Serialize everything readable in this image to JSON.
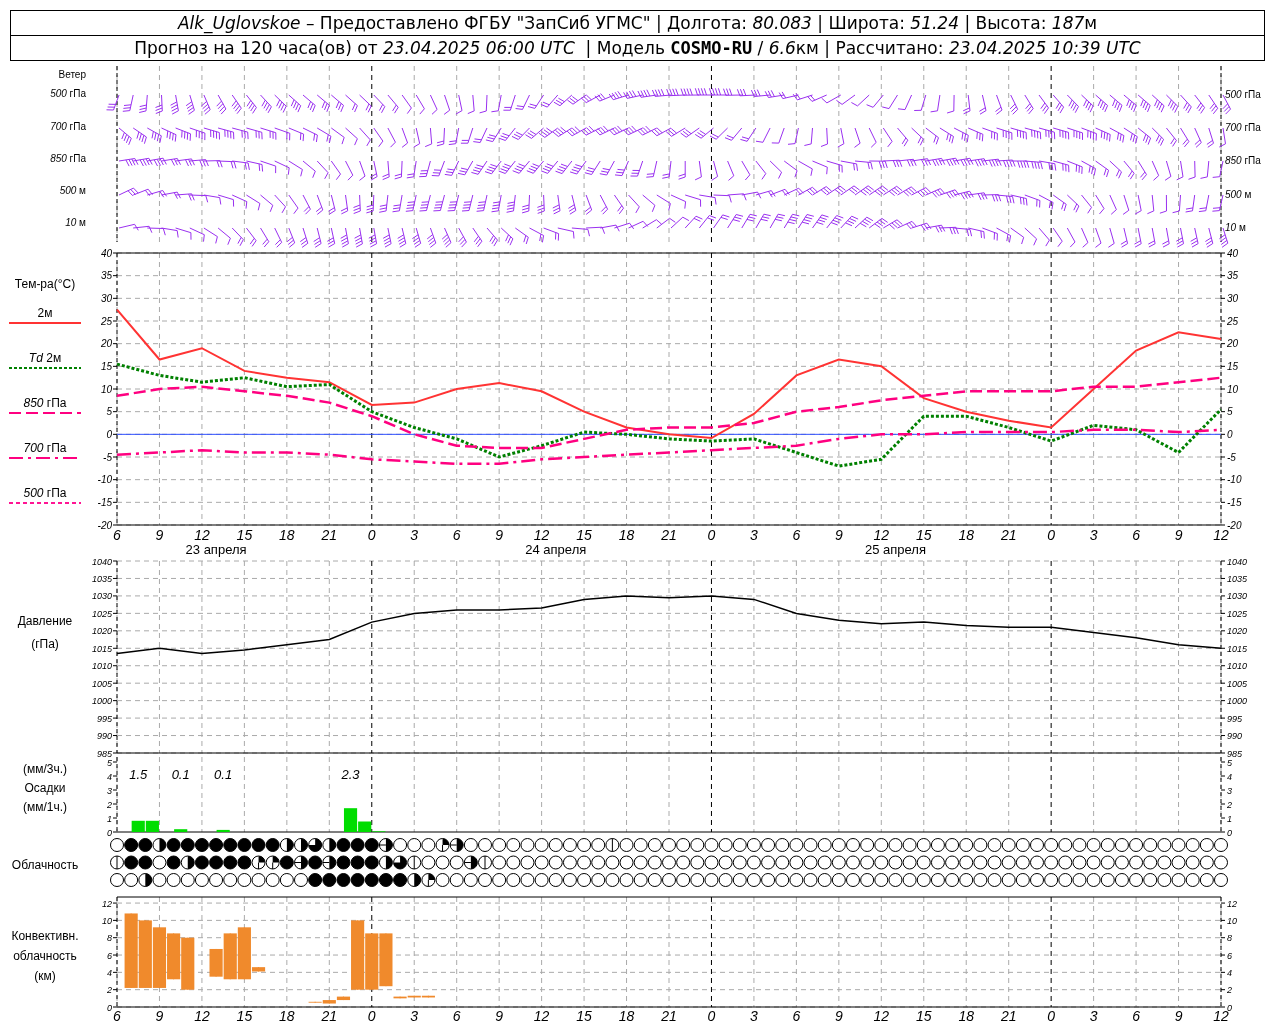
{
  "header": {
    "line_1": {
      "station": "Alk_Uglovskoe",
      "source": " – Предоставлено ФГБУ \"ЗапСиб УГМС\" | Долгота: ",
      "longitude": "80.083",
      "latitude_label": " | Широта: ",
      "latitude": "51.24",
      "altitude_label": " | Высота: ",
      "altitude": "187",
      "altitude_unit": "м"
    },
    "line_2": {
      "prefix": "Прогноз на 120 часа(ов) от ",
      "start": "23.04.2025 06:00 UTC",
      "model_label": "  | Модель ",
      "model": "COSMO-RU",
      "separator": " / ",
      "resolution": "6.6",
      "calc_label": "км | Рассчитано: ",
      "calculated": "23.04.2025 10:39 UTC"
    }
  },
  "wind": {
    "title": "Ветер",
    "levels_left": [
      "*500* гПа",
      "*700* гПа",
      "*850* гПа",
      "*500* м",
      "*10* м"
    ],
    "levels_right": [
      "*500* гПа",
      "*700* гПа",
      "*850* гПа",
      "*500* м",
      "*10* м"
    ]
  },
  "temperature": {
    "title": "Тем-ра(°C)",
    "legend": [
      {
        "label": "2м",
        "color": "#ff3333",
        "kind": "solid"
      },
      {
        "label": "*Td* 2м",
        "color": "#008000",
        "kind": "dotted"
      },
      {
        "label": "*850* гПа",
        "color": "#ff0080",
        "kind": "dashed"
      },
      {
        "label": "*700* гПа",
        "color": "#ff0080",
        "kind": "dashdot"
      },
      {
        "label": "*500* гПа",
        "color": "#ff1493",
        "kind": "short"
      }
    ],
    "chart_data": {
      "type": "line",
      "grid": true,
      "categories": [
        "6",
        "9",
        "12",
        "15",
        "18",
        "21",
        "0",
        "3",
        "6",
        "9",
        "12",
        "15",
        "18",
        "21",
        "0",
        "3",
        "6",
        "9",
        "12",
        "15",
        "18",
        "21",
        "0",
        "3",
        "6",
        "9",
        "12"
      ],
      "series": [
        {
          "color": "#ff3333",
          "line_style": "solid",
          "values": [
            27.5,
            16.5,
            19,
            14,
            12.5,
            11.5,
            6.5,
            7,
            10,
            11.3,
            9.5,
            5,
            1.5,
            0,
            -0.8,
            4.5,
            13,
            16.5,
            15,
            8,
            5,
            3,
            1.5,
            10,
            18.5,
            22.5,
            21
          ]
        },
        {
          "color": "#008000",
          "line_style": "dotted",
          "values": [
            15.5,
            13,
            11.5,
            12.5,
            10.5,
            11,
            5,
            1.5,
            -1,
            -5,
            -2.5,
            0.5,
            0,
            -1,
            -1.5,
            -1,
            -4,
            -7,
            -5.5,
            4,
            4,
            1.5,
            -1.5,
            2,
            1,
            -4,
            5.5
          ]
        },
        {
          "color": "#ff0080",
          "line_style": "dashed",
          "values": [
            8.5,
            10,
            10.5,
            9.5,
            8.5,
            7,
            4,
            0,
            -2.5,
            -3,
            -3,
            -1,
            1,
            1.5,
            1.5,
            2.5,
            5,
            6,
            7.5,
            8.5,
            9.5,
            9.5,
            9.5,
            10.5,
            10.5,
            11.5,
            12.5
          ]
        },
        {
          "color": "#ff0080",
          "line_style": "dashdot",
          "values": [
            -4.5,
            -4,
            -3.5,
            -4,
            -4,
            -4.5,
            -5.5,
            -6,
            -6.5,
            -6.5,
            -5.5,
            -5,
            -4.5,
            -4,
            -3.5,
            -3,
            -2.5,
            -1,
            0,
            0,
            0.5,
            0.5,
            0.5,
            1,
            1,
            0.5,
            1
          ]
        }
      ],
      "ref_lines": [
        {
          "axis": "y",
          "value": 0,
          "color": "#3050ff"
        }
      ],
      "ylim": [
        -20,
        40
      ],
      "yticks": [
        -20,
        -15,
        -10,
        -5,
        0,
        5,
        10,
        15,
        20,
        25,
        30,
        35,
        40
      ]
    },
    "right_axis_labels": [
      "40",
      "35",
      "30",
      "25",
      "20",
      "15",
      "10",
      "5",
      "0",
      "-5",
      "-10",
      "-15",
      "-20"
    ],
    "day_labels": [
      "23 апреля",
      "24 апреля",
      "25 апреля"
    ]
  },
  "pressure": {
    "title": "Давление",
    "unit": "(гПа)",
    "right_axis_labels": [
      "1040",
      "1035",
      "1030",
      "1025",
      "1020",
      "1015",
      "1010",
      "1005",
      "1000",
      "995",
      "990",
      "985"
    ],
    "chart_data": {
      "type": "line",
      "grid": true,
      "categories": [
        null,
        null,
        null,
        null,
        null,
        null,
        null,
        null,
        null,
        null,
        null,
        null,
        null,
        null,
        null,
        null,
        null,
        null,
        null,
        null,
        null,
        null,
        null,
        null,
        null,
        null,
        null
      ],
      "series": [
        {
          "color": "#000000",
          "values": [
            1013.5,
            1015,
            1013.5,
            1014.5,
            1016,
            1017.5,
            1022.5,
            1025,
            1026,
            1026,
            1026.5,
            1029,
            1030,
            1029.5,
            1030,
            1029,
            1025,
            1023,
            1022,
            1022.5,
            1021.5,
            1021,
            1021,
            1019.5,
            1018,
            1016,
            1015
          ]
        }
      ],
      "ylim": [
        985,
        1040
      ],
      "yticks": [
        985,
        990,
        995,
        1000,
        1005,
        1010,
        1015,
        1020,
        1025,
        1030,
        1035,
        1040
      ]
    }
  },
  "precipitation": {
    "unit_top": "(мм/3ч.)",
    "title": "Осадки",
    "unit_bottom": "(мм/1ч.)",
    "right_axis_labels": [
      "5",
      "4",
      "3",
      "2",
      "1",
      "0"
    ],
    "chart_data": {
      "type": "bar",
      "grid": true,
      "categories": [
        null,
        null,
        null,
        null,
        null,
        null,
        null,
        null,
        null,
        null,
        null,
        null,
        null,
        null,
        null,
        null,
        null,
        null,
        null,
        null,
        null,
        null,
        null,
        null,
        null,
        null,
        null,
        null,
        null,
        null,
        null,
        null,
        null,
        null,
        null,
        null,
        null,
        null,
        null,
        null,
        null,
        null,
        null,
        null,
        null,
        null,
        null,
        null,
        null,
        null,
        null,
        null,
        null,
        null,
        null,
        null,
        null,
        null,
        null,
        null,
        null,
        null,
        null,
        null,
        null,
        null,
        null,
        null,
        null,
        null,
        null,
        null,
        null,
        null,
        null,
        null,
        null,
        null
      ],
      "series": [
        {
          "color": "#00dd00",
          "values": [
            0,
            0.8,
            0.8,
            0,
            0.2,
            0,
            0,
            0.15,
            0,
            0,
            0,
            0,
            0,
            0,
            0,
            0,
            1.7,
            0.75,
            0.05,
            0,
            0,
            0,
            0,
            0,
            0,
            0,
            0,
            0,
            0,
            0,
            0,
            0,
            0,
            0,
            0,
            0,
            0,
            0,
            0,
            0,
            0,
            0,
            0,
            0,
            0,
            0,
            0,
            0,
            0,
            0,
            0,
            0,
            0,
            0,
            0,
            0,
            0,
            0,
            0,
            0,
            0,
            0,
            0,
            0,
            0,
            0,
            0,
            0,
            0,
            0,
            0,
            0,
            0,
            0,
            0,
            0,
            0,
            0
          ]
        }
      ],
      "ylim": [
        0,
        5
      ],
      "yticks": [
        0,
        1,
        2,
        3,
        4,
        5
      ],
      "annotations": [
        "1.5",
        "0.1",
        "0.1",
        "2.3"
      ]
    }
  },
  "cloudiness": {
    "title": "Облачность",
    "rows": [
      {
        "cells": [
          {
            "kind": "clear"
          },
          {
            "kind": "overcast"
          },
          {
            "kind": "overcast"
          },
          {
            "kind": "half"
          },
          {
            "kind": "overcast"
          },
          {
            "kind": "overcast"
          },
          {
            "kind": "overcast"
          },
          {
            "kind": "overcast"
          },
          {
            "kind": "overcast"
          },
          {
            "kind": "overcast"
          },
          {
            "kind": "overcast"
          },
          {
            "kind": "overcast"
          },
          {
            "kind": "half"
          },
          {
            "kind": "half"
          },
          {
            "kind": "most"
          },
          {
            "kind": "half"
          },
          {
            "kind": "overcast"
          },
          {
            "kind": "overcast"
          },
          {
            "kind": "overcast"
          },
          {
            "kind": "split"
          },
          {
            "kind": "clear"
          },
          {
            "kind": "clear"
          },
          {
            "kind": "clear"
          },
          {
            "kind": "quarter"
          },
          {
            "kind": "split"
          },
          {
            "kind": "clear"
          },
          {
            "kind": "clear"
          },
          {
            "kind": "clear"
          },
          {
            "kind": "clear"
          },
          {
            "kind": "clear"
          },
          {
            "kind": "clear"
          },
          {
            "kind": "clear"
          },
          {
            "kind": "clear"
          },
          {
            "kind": "clear"
          },
          {
            "kind": "clear"
          },
          {
            "kind": "trace"
          },
          {
            "kind": "clear"
          },
          {
            "kind": "clear"
          },
          {
            "kind": "clear"
          },
          {
            "kind": "clear"
          },
          {
            "kind": "clear"
          },
          {
            "kind": "clear"
          },
          {
            "kind": "clear"
          },
          {
            "kind": "clear"
          },
          {
            "kind": "clear"
          },
          {
            "kind": "clear"
          },
          {
            "kind": "clear"
          },
          {
            "kind": "clear"
          },
          {
            "kind": "clear"
          },
          {
            "kind": "clear"
          },
          {
            "kind": "clear"
          },
          {
            "kind": "clear"
          },
          {
            "kind": "clear"
          },
          {
            "kind": "clear"
          },
          {
            "kind": "clear"
          },
          {
            "kind": "clear"
          },
          {
            "kind": "clear"
          },
          {
            "kind": "clear"
          },
          {
            "kind": "clear"
          },
          {
            "kind": "clear"
          },
          {
            "kind": "clear"
          },
          {
            "kind": "clear"
          },
          {
            "kind": "clear"
          },
          {
            "kind": "clear"
          },
          {
            "kind": "clear"
          },
          {
            "kind": "clear"
          },
          {
            "kind": "clear"
          },
          {
            "kind": "clear"
          },
          {
            "kind": "clear"
          },
          {
            "kind": "clear"
          },
          {
            "kind": "clear"
          },
          {
            "kind": "clear"
          },
          {
            "kind": "clear"
          },
          {
            "kind": "clear"
          },
          {
            "kind": "clear"
          },
          {
            "kind": "clear"
          },
          {
            "kind": "clear"
          },
          {
            "kind": "clear"
          },
          {
            "kind": "clear"
          }
        ]
      },
      {
        "cells": [
          {
            "kind": "trace"
          },
          {
            "kind": "overcast"
          },
          {
            "kind": "overcast"
          },
          {
            "kind": "clear"
          },
          {
            "kind": "overcast"
          },
          {
            "kind": "half"
          },
          {
            "kind": "overcast"
          },
          {
            "kind": "overcast"
          },
          {
            "kind": "overcast"
          },
          {
            "kind": "overcast"
          },
          {
            "kind": "quarter"
          },
          {
            "kind": "quarter"
          },
          {
            "kind": "overcast"
          },
          {
            "kind": "split"
          },
          {
            "kind": "overcast"
          },
          {
            "kind": "split"
          },
          {
            "kind": "overcast"
          },
          {
            "kind": "overcast"
          },
          {
            "kind": "overcast"
          },
          {
            "kind": "half"
          },
          {
            "kind": "most"
          },
          {
            "kind": "trace"
          },
          {
            "kind": "clear"
          },
          {
            "kind": "clear"
          },
          {
            "kind": "clear"
          },
          {
            "kind": "split"
          },
          {
            "kind": "trace"
          },
          {
            "kind": "clear"
          },
          {
            "kind": "clear"
          },
          {
            "kind": "clear"
          },
          {
            "kind": "clear"
          },
          {
            "kind": "clear"
          },
          {
            "kind": "clear"
          },
          {
            "kind": "clear"
          },
          {
            "kind": "clear"
          },
          {
            "kind": "clear"
          },
          {
            "kind": "clear"
          },
          {
            "kind": "clear"
          },
          {
            "kind": "clear"
          },
          {
            "kind": "clear"
          },
          {
            "kind": "clear"
          },
          {
            "kind": "clear"
          },
          {
            "kind": "clear"
          },
          {
            "kind": "clear"
          },
          {
            "kind": "clear"
          },
          {
            "kind": "clear"
          },
          {
            "kind": "clear"
          },
          {
            "kind": "clear"
          },
          {
            "kind": "clear"
          },
          {
            "kind": "clear"
          },
          {
            "kind": "clear"
          },
          {
            "kind": "clear"
          },
          {
            "kind": "clear"
          },
          {
            "kind": "clear"
          },
          {
            "kind": "clear"
          },
          {
            "kind": "clear"
          },
          {
            "kind": "clear"
          },
          {
            "kind": "clear"
          },
          {
            "kind": "clear"
          },
          {
            "kind": "clear"
          },
          {
            "kind": "clear"
          },
          {
            "kind": "clear"
          },
          {
            "kind": "clear"
          },
          {
            "kind": "clear"
          },
          {
            "kind": "clear"
          },
          {
            "kind": "clear"
          },
          {
            "kind": "clear"
          },
          {
            "kind": "clear"
          },
          {
            "kind": "clear"
          },
          {
            "kind": "clear"
          },
          {
            "kind": "clear"
          },
          {
            "kind": "clear"
          },
          {
            "kind": "clear"
          },
          {
            "kind": "clear"
          },
          {
            "kind": "clear"
          },
          {
            "kind": "clear"
          },
          {
            "kind": "clear"
          },
          {
            "kind": "clear"
          },
          {
            "kind": "clear"
          }
        ]
      },
      {
        "cells": [
          {
            "kind": "clear"
          },
          {
            "kind": "clear"
          },
          {
            "kind": "half"
          },
          {
            "kind": "clear"
          },
          {
            "kind": "clear"
          },
          {
            "kind": "clear"
          },
          {
            "kind": "clear"
          },
          {
            "kind": "clear"
          },
          {
            "kind": "clear"
          },
          {
            "kind": "clear"
          },
          {
            "kind": "clear"
          },
          {
            "kind": "clear"
          },
          {
            "kind": "clear"
          },
          {
            "kind": "clear"
          },
          {
            "kind": "overcast"
          },
          {
            "kind": "overcast"
          },
          {
            "kind": "overcast"
          },
          {
            "kind": "overcast"
          },
          {
            "kind": "overcast"
          },
          {
            "kind": "overcast"
          },
          {
            "kind": "overcast"
          },
          {
            "kind": "half"
          },
          {
            "kind": "quarter"
          },
          {
            "kind": "clear"
          },
          {
            "kind": "clear"
          },
          {
            "kind": "clear"
          },
          {
            "kind": "clear"
          },
          {
            "kind": "clear"
          },
          {
            "kind": "clear"
          },
          {
            "kind": "clear"
          },
          {
            "kind": "clear"
          },
          {
            "kind": "clear"
          },
          {
            "kind": "clear"
          },
          {
            "kind": "clear"
          },
          {
            "kind": "clear"
          },
          {
            "kind": "clear"
          },
          {
            "kind": "clear"
          },
          {
            "kind": "clear"
          },
          {
            "kind": "clear"
          },
          {
            "kind": "clear"
          },
          {
            "kind": "clear"
          },
          {
            "kind": "clear"
          },
          {
            "kind": "clear"
          },
          {
            "kind": "clear"
          },
          {
            "kind": "clear"
          },
          {
            "kind": "clear"
          },
          {
            "kind": "clear"
          },
          {
            "kind": "clear"
          },
          {
            "kind": "clear"
          },
          {
            "kind": "clear"
          },
          {
            "kind": "clear"
          },
          {
            "kind": "clear"
          },
          {
            "kind": "clear"
          },
          {
            "kind": "clear"
          },
          {
            "kind": "clear"
          },
          {
            "kind": "clear"
          },
          {
            "kind": "clear"
          },
          {
            "kind": "clear"
          },
          {
            "kind": "clear"
          },
          {
            "kind": "clear"
          },
          {
            "kind": "clear"
          },
          {
            "kind": "clear"
          },
          {
            "kind": "clear"
          },
          {
            "kind": "clear"
          },
          {
            "kind": "clear"
          },
          {
            "kind": "clear"
          },
          {
            "kind": "clear"
          },
          {
            "kind": "clear"
          },
          {
            "kind": "clear"
          },
          {
            "kind": "clear"
          },
          {
            "kind": "clear"
          },
          {
            "kind": "clear"
          },
          {
            "kind": "clear"
          },
          {
            "kind": "clear"
          },
          {
            "kind": "clear"
          },
          {
            "kind": "clear"
          },
          {
            "kind": "clear"
          },
          {
            "kind": "clear"
          },
          {
            "kind": "clear"
          }
        ]
      }
    ]
  },
  "convective": {
    "title": "Конвективн.",
    "subtitle": "облачность",
    "unit": "(км)",
    "right_axis_labels": [
      "12",
      "10",
      "8",
      "6",
      "4",
      "2",
      "0"
    ],
    "chart_data": {
      "type": "candlestick",
      "grid": true,
      "categories": [
        "6",
        null,
        null,
        "9",
        null,
        null,
        "12",
        null,
        null,
        "15",
        null,
        null,
        "18",
        null,
        null,
        "21",
        null,
        null,
        "0",
        null,
        null,
        "3",
        null,
        null,
        "6",
        null,
        null,
        "9",
        null,
        null,
        "12",
        null,
        null,
        "15",
        null,
        null,
        "18",
        null,
        null,
        "21",
        null,
        null,
        "0",
        null,
        null,
        "3",
        null,
        null,
        "6",
        null,
        null,
        "9",
        null,
        null,
        "12",
        null,
        null,
        "15",
        null,
        null,
        "18",
        null,
        null,
        "21",
        null,
        null,
        "0",
        null,
        null,
        "3",
        null,
        null,
        "6",
        null,
        null,
        "9",
        null,
        null,
        "12"
      ],
      "series": [
        {
          "color": "#f08a2c",
          "ohlc": [
            null,
            [
              2.2,
              10.8,
              2.2,
              10.8
            ],
            [
              2.2,
              10,
              2.2,
              10
            ],
            [
              2.2,
              9.2,
              2.2,
              9.2
            ],
            [
              3.2,
              8.5,
              3.2,
              8.5
            ],
            [
              2,
              8,
              2,
              8
            ],
            null,
            [
              3.5,
              6.7,
              3.5,
              6.7
            ],
            [
              3.2,
              8.5,
              3.2,
              8.5
            ],
            [
              3.2,
              9.2,
              3.2,
              9.2
            ],
            [
              4.1,
              4.6,
              4.1,
              4.6
            ],
            null,
            null,
            null,
            [
              0.5,
              0.6,
              0.5,
              0.6
            ],
            [
              0.4,
              0.8,
              0.4,
              0.8
            ],
            [
              0.8,
              1.2,
              0.8,
              1.2
            ],
            [
              2,
              10,
              2,
              10
            ],
            [
              2,
              8.5,
              2,
              8.5
            ],
            [
              2.4,
              8.5,
              2.4,
              8.5
            ],
            [
              1,
              1.2,
              1,
              1.2
            ],
            [
              1.1,
              1.3,
              1.1,
              1.3
            ],
            [
              1.1,
              1.3,
              1.1,
              1.3
            ],
            null,
            null,
            null,
            null,
            null,
            null,
            null,
            null,
            null,
            null,
            null,
            null,
            null,
            null,
            null,
            null,
            null,
            null,
            null,
            null,
            null,
            null,
            null,
            null,
            null,
            null,
            null,
            null,
            null,
            null,
            null,
            null,
            null,
            null,
            null,
            null,
            null,
            null,
            null,
            null,
            null,
            null,
            null,
            null,
            null,
            null,
            null,
            null,
            null,
            null,
            null,
            null,
            null,
            null,
            null,
            null
          ]
        }
      ],
      "ylim": [
        0,
        12.7
      ],
      "yticks": [
        0,
        2,
        4,
        6,
        8,
        10,
        12
      ]
    }
  }
}
